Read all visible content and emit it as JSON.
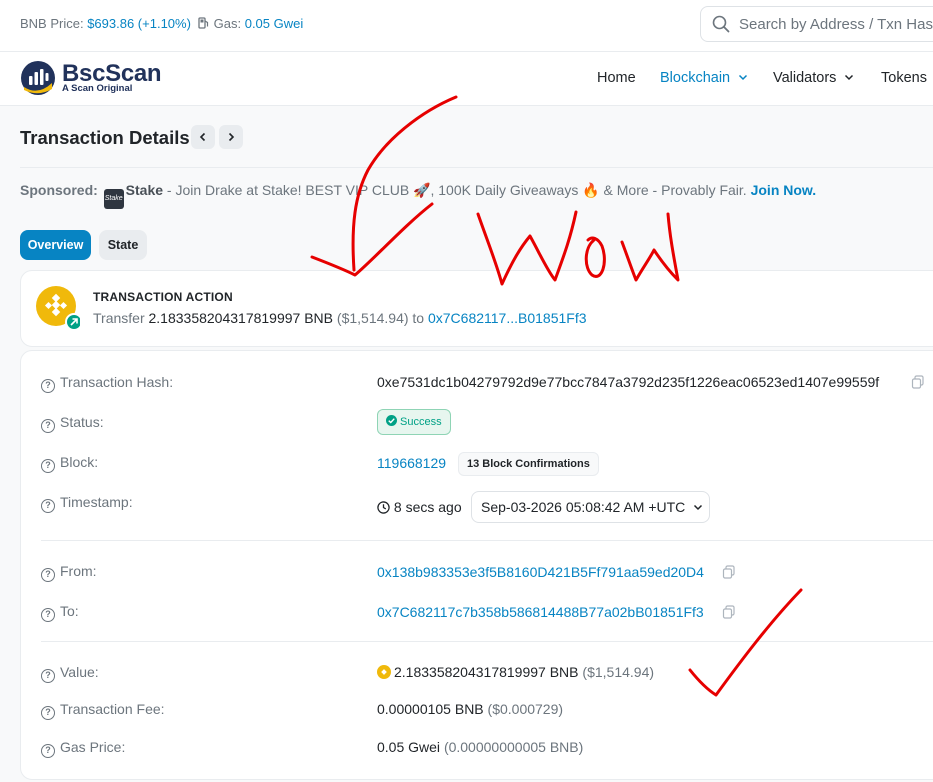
{
  "topbar": {
    "bnb_price_label": "BNB Price:",
    "bnb_price_value": "$693.86 (+1.10%)",
    "gas_label": "Gas:",
    "gas_value": "0.05 Gwei",
    "search_placeholder": "Search by Address / Txn Hash"
  },
  "brand": {
    "name": "BscScan",
    "tagline": "A Scan Original"
  },
  "nav": {
    "home": "Home",
    "blockchain": "Blockchain",
    "validators": "Validators",
    "tokens": "Tokens"
  },
  "page": {
    "title": "Transaction Details"
  },
  "sponsored": {
    "label": "Sponsored:",
    "logo_text": "Stake",
    "name": "Stake",
    "text": " - Join Drake at Stake! BEST VIP CLUB 🚀, 100K Daily Giveaways 🔥 & More - Provably Fair. ",
    "cta": "Join Now."
  },
  "tabs": {
    "overview": "Overview",
    "state": "State"
  },
  "action": {
    "title": "TRANSACTION ACTION",
    "verb": "Transfer",
    "amount": "2.183358204317819997 BNB",
    "usd": "($1,514.94)",
    "to_word": "to",
    "to_address": "0x7C682117...B01851Ff3"
  },
  "details": {
    "hash_label": "Transaction Hash:",
    "hash_value": "0xe7531dc1b04279792d9e77bcc7847a3792d235f1226eac06523ed1407e99559f",
    "status_label": "Status:",
    "status_value": "Success",
    "block_label": "Block:",
    "block_value": "119668129",
    "block_confirmations": "13 Block Confirmations",
    "timestamp_label": "Timestamp:",
    "timestamp_ago": "8 secs ago",
    "timestamp_value": "Sep-03-2026 05:08:42 AM +UTC",
    "from_label": "From:",
    "from_value": "0x138b983353e3f5B8160D421B5Ff791aa59ed20D4",
    "to_label": "To:",
    "to_value": "0x7C682117c7b358b586814488B77a02bB01851Ff3",
    "value_label": "Value:",
    "value_amount": "2.183358204317819997 BNB",
    "value_usd": "($1,514.94)",
    "fee_label": "Transaction Fee:",
    "fee_amount": "0.00000105 BNB",
    "fee_usd": "($0.000729)",
    "gas_price_label": "Gas Price:",
    "gas_price_value": "0.05 Gwei",
    "gas_price_bnb": "(0.00000000005 BNB)"
  },
  "annotations": {
    "handwritten_text": "WoW"
  },
  "colors": {
    "accent": "#0784c3",
    "brand_dark": "#21325b",
    "bnb_yellow": "#f0b90b",
    "success": "#00a186",
    "annotation_red": "#e60000"
  }
}
